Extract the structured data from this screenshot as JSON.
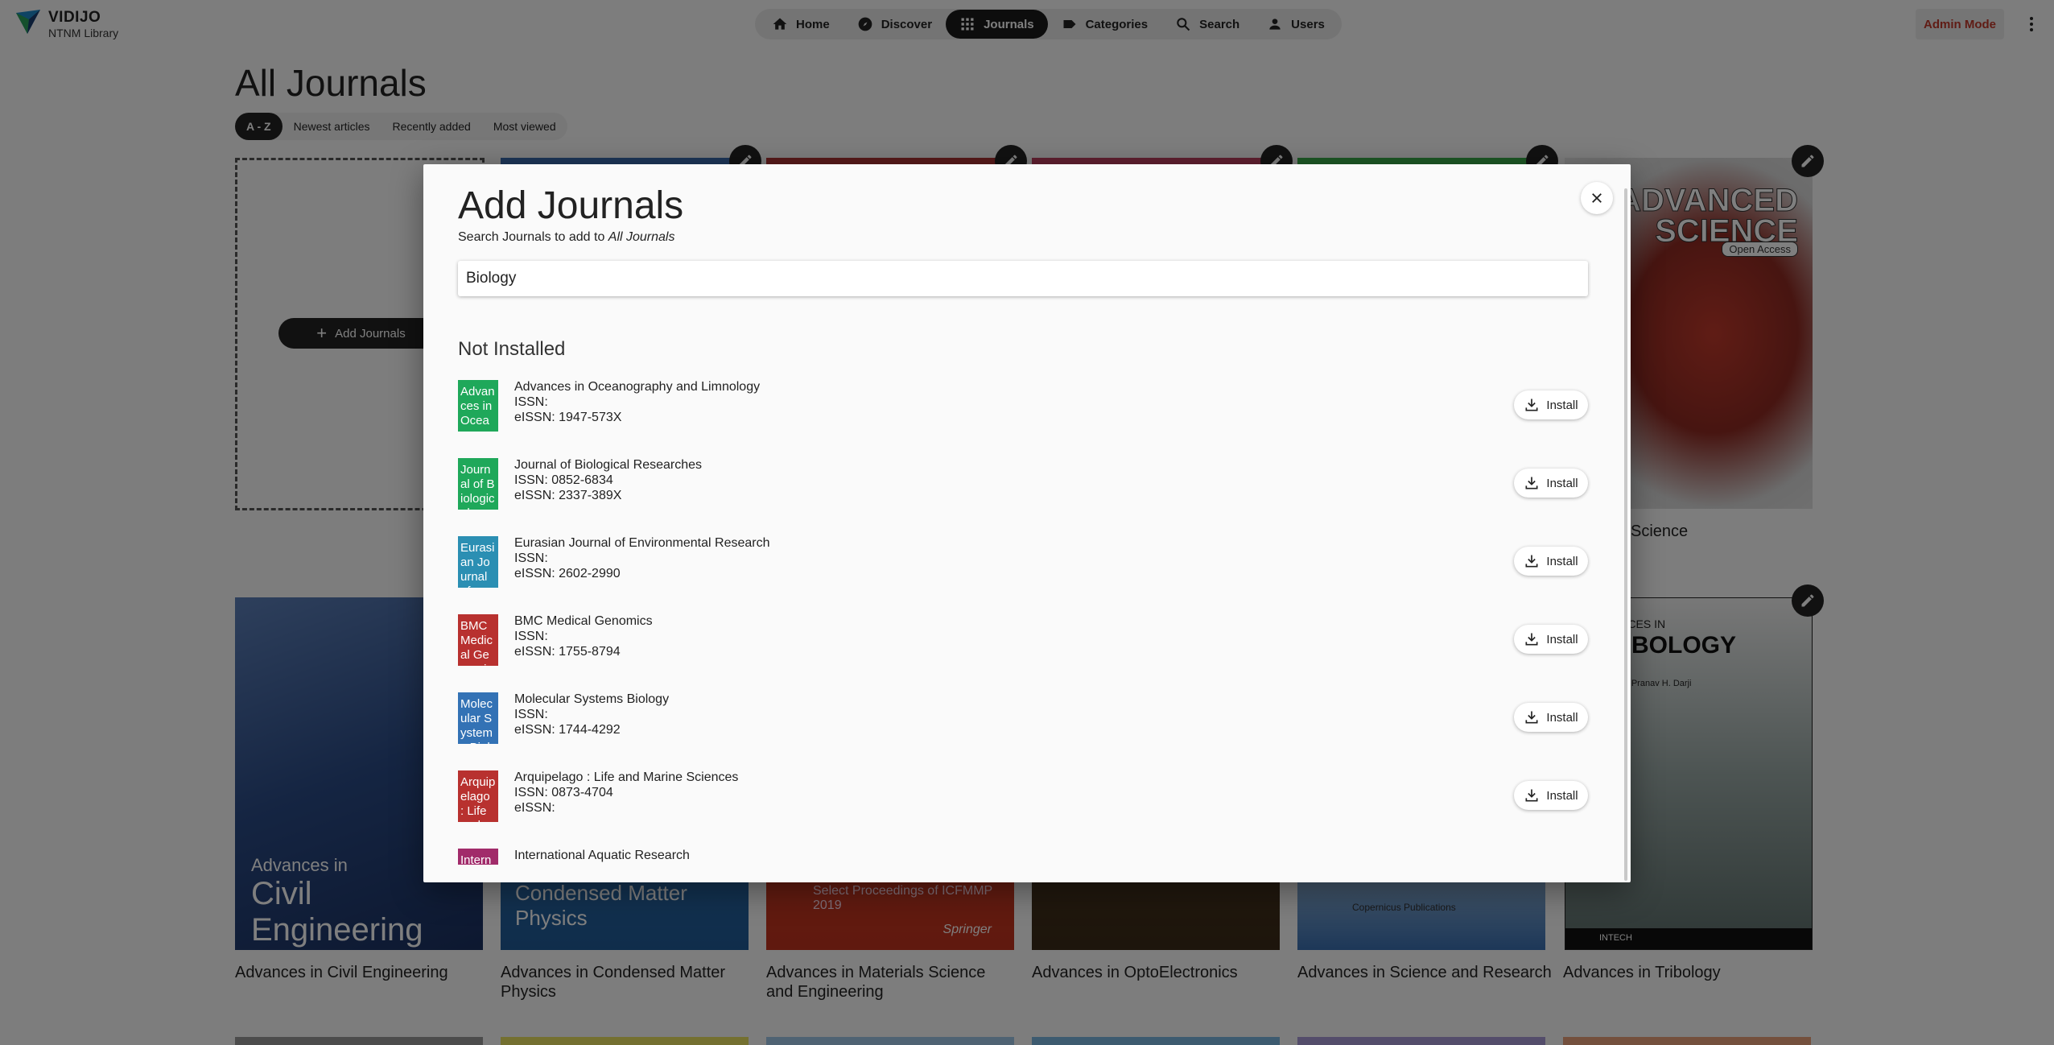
{
  "app": {
    "brand": "VIDIJO",
    "org": "NTNM Library",
    "admin_label": "Admin Mode"
  },
  "nav": [
    {
      "label": "Home",
      "icon": "home-icon"
    },
    {
      "label": "Discover",
      "icon": "compass-icon"
    },
    {
      "label": "Journals",
      "icon": "grid-icon",
      "active": true
    },
    {
      "label": "Categories",
      "icon": "label-icon"
    },
    {
      "label": "Search",
      "icon": "search-icon"
    },
    {
      "label": "Users",
      "icon": "person-icon"
    }
  ],
  "page": {
    "title": "All Journals",
    "sort_tabs": [
      "A - Z",
      "Newest articles",
      "Recently added",
      "Most viewed"
    ],
    "add_button": "Add Journals"
  },
  "covers": {
    "advanced_science": {
      "title_line1": "ADVANCED",
      "title_line2": "SCIENCE",
      "badge": "Open Access",
      "caption_partial": "l Science"
    },
    "civil": {
      "small": "Advances in",
      "big": "Civil Engineering",
      "caption": "Advances in Civil Engineering"
    },
    "condensed": {
      "text": "Condensed Matter Physics",
      "caption": "Advances in Condensed Matter Physics"
    },
    "materials": {
      "text": "Select Proceedings of ICFMMP 2019",
      "publisher": "Springer",
      "caption": "Advances in Materials Science and Engineering"
    },
    "opto": {
      "caption": "Advances in OptoElectronics"
    },
    "science_research": {
      "publisher": "Copernicus Publications",
      "caption": "Advances in Science and Research"
    },
    "tribology": {
      "small": "ANCES IN",
      "big": "RIBOLOGY",
      "editor": "d by Pranav H. Darji",
      "publisher": "INTECH",
      "caption": "Advances in Tribology"
    }
  },
  "dialog": {
    "title": "Add Journals",
    "subtitle_prefix": "Search Journals to add to ",
    "subtitle_target": "All Journals",
    "search_value": "Biology",
    "section": "Not Installed",
    "install_label": "Install",
    "results": [
      {
        "name": "Advances in Oceanography and Limnology",
        "issn": "ISSN:",
        "eissn": "eISSN: 1947-573X",
        "thumb": "Advances in Oceanography",
        "color": "green"
      },
      {
        "name": "Journal of Biological Researches",
        "issn": "ISSN: 0852-6834",
        "eissn": "eISSN: 2337-389X",
        "thumb": "Journal of Biological",
        "color": "green"
      },
      {
        "name": "Eurasian Journal of Environmental Research",
        "issn": "ISSN:",
        "eissn": "eISSN: 2602-2990",
        "thumb": "Eurasian Journal of",
        "color": "teal"
      },
      {
        "name": "BMC Medical Genomics",
        "issn": "ISSN:",
        "eissn": "eISSN: 1755-8794",
        "thumb": "BMC Medical Genomics",
        "color": "red"
      },
      {
        "name": "Molecular Systems Biology",
        "issn": "ISSN:",
        "eissn": "eISSN: 1744-4292",
        "thumb": "Molecular Systems Biology",
        "color": "blue"
      },
      {
        "name": "Arquipelago : Life and Marine Sciences",
        "issn": "ISSN: 0873-4704",
        "eissn": "eISSN:",
        "thumb": "Arquipelago : Life and",
        "color": "red"
      },
      {
        "name": "International Aquatic Research",
        "issn": "",
        "eissn": "",
        "thumb": "International",
        "color": "pink"
      }
    ]
  }
}
